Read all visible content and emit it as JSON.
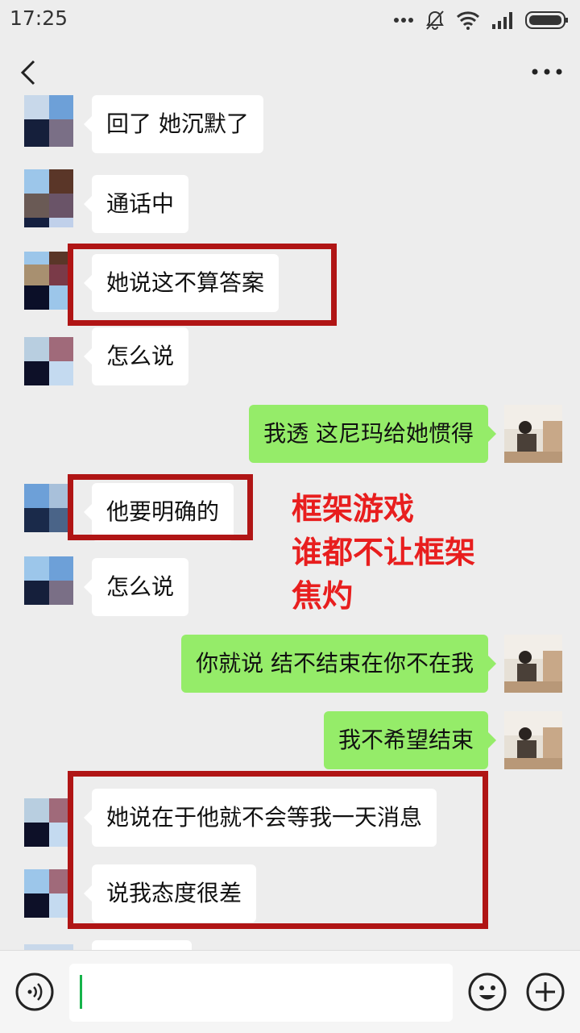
{
  "status_bar": {
    "time": "17:25"
  },
  "chat": {
    "messages": [
      {
        "side": "in",
        "text": "回了 她沉默了"
      },
      {
        "side": "in",
        "text": "通话中"
      },
      {
        "side": "in",
        "text": "她说这不算答案"
      },
      {
        "side": "in",
        "text": "怎么说"
      },
      {
        "side": "out",
        "text": "我透 这尼玛给她惯得"
      },
      {
        "side": "in",
        "text": "他要明确的"
      },
      {
        "side": "in",
        "text": "怎么说"
      },
      {
        "side": "out",
        "text": "你就说 结不结束在你不在我"
      },
      {
        "side": "out",
        "text": "我不希望结束"
      },
      {
        "side": "in",
        "text": "她说在于他就不会等我一天消息"
      },
      {
        "side": "in",
        "text": "说我态度很差"
      }
    ]
  },
  "annotation": {
    "lines": [
      "框架游戏",
      "谁都不让框架",
      "焦灼"
    ],
    "color": "#e81e1e"
  },
  "colors": {
    "background": "#ededed",
    "outgoing_bubble": "#95ec69",
    "incoming_bubble": "#ffffff",
    "highlight_box": "#b01515",
    "caret": "#16b34a"
  },
  "icons": [
    "back-icon",
    "more-icon",
    "voice-icon",
    "emoji-icon",
    "plus-icon",
    "wifi-icon",
    "signal-icon",
    "battery-icon",
    "mute-icon"
  ]
}
